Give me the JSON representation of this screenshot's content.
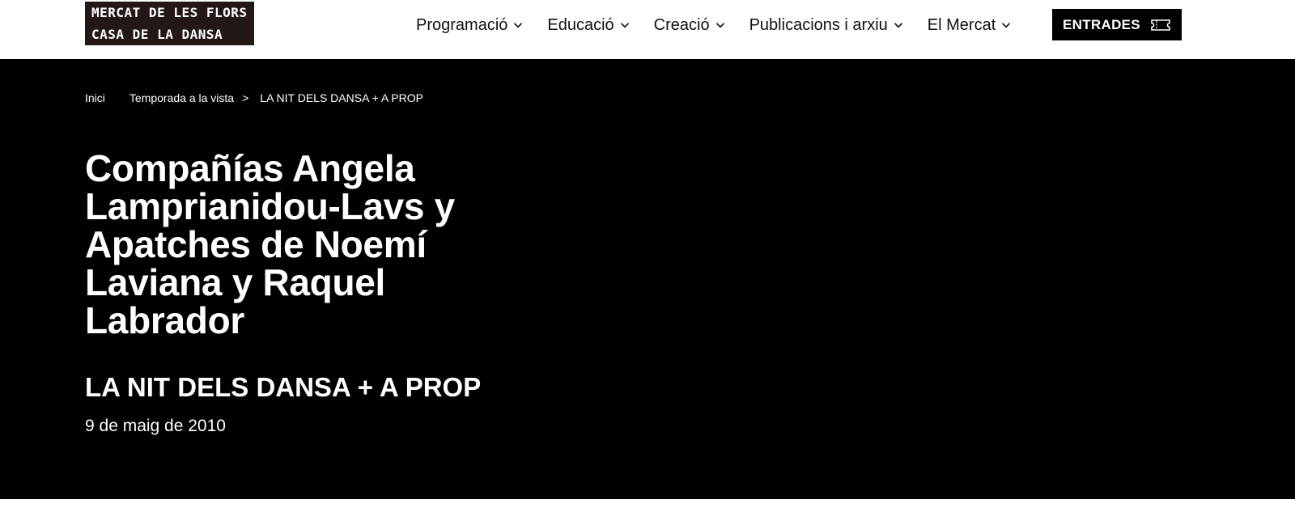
{
  "header": {
    "logo": {
      "line1": "MERCAT DE LES FLORS",
      "line2": "CASA DE LA DANSA"
    },
    "nav": [
      {
        "label": "Programació",
        "icon": "chevron-down-icon"
      },
      {
        "label": "Educació",
        "icon": "chevron-down-icon"
      },
      {
        "label": "Creació",
        "icon": "chevron-down-icon"
      },
      {
        "label": "Publicacions i arxiu",
        "icon": "chevron-down-icon"
      },
      {
        "label": "El Mercat",
        "icon": "chevron-down-icon"
      }
    ],
    "tickets_button": {
      "label": "ENTRADES",
      "icon": "ticket-icon"
    }
  },
  "hero": {
    "breadcrumb": {
      "home": "Inici",
      "section": "Temporada a la vista",
      "separator": ">",
      "current": "LA NIT DELS DANSA + A PROP"
    },
    "title": "Compañías Angela Lamprianidou-Lavs y Apatches de Noemí Laviana y Raquel Labrador",
    "subtitle": "LA NIT DELS DANSA + A PROP",
    "date": "9 de maig de 2010"
  },
  "colors": {
    "hero_background": "#000000",
    "logo_background": "#231815",
    "button_background": "#000000",
    "text_on_dark": "#ffffff"
  }
}
